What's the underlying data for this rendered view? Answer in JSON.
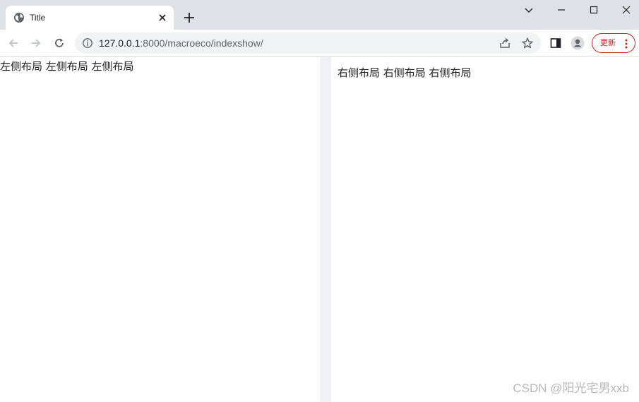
{
  "browser": {
    "tab": {
      "title": "Title",
      "favicon": "globe-icon"
    },
    "address": {
      "url_host": "127.0.0.1",
      "url_rest": ":8000/macroeco/indexshow/"
    },
    "update_button_label": "更新",
    "colors": {
      "titlebar": "#dee1e6",
      "omnibox": "#f1f3f4",
      "update_accent": "#c5221f"
    }
  },
  "page": {
    "left_text": "左侧布局 左侧布局 左侧布局",
    "right_text": "右侧布局 右侧布局 右侧布局",
    "divider_color": "#f0f0f7"
  },
  "watermark": "CSDN @阳光宅男xxb"
}
